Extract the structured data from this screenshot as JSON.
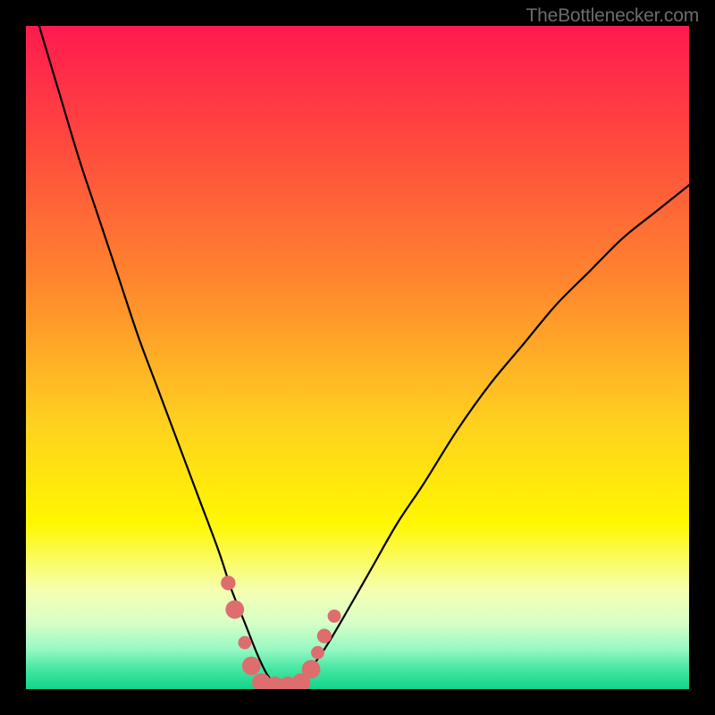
{
  "watermark": "TheBottlenecker.com",
  "chart_data": {
    "type": "line",
    "title": "",
    "xlabel": "",
    "ylabel": "",
    "xlim": [
      0,
      100
    ],
    "ylim": [
      0,
      100
    ],
    "grid": false,
    "series": [
      {
        "name": "bottleneck-curve",
        "x": [
          2,
          5,
          8,
          11,
          14,
          17,
          20,
          23,
          26,
          29,
          31,
          33,
          35,
          36.5,
          38,
          40,
          42,
          45,
          48,
          52,
          56,
          60,
          65,
          70,
          75,
          80,
          85,
          90,
          95,
          100
        ],
        "y": [
          100,
          90,
          80,
          71,
          62,
          53,
          45,
          37,
          29,
          21,
          15,
          10,
          5,
          2,
          0.5,
          0.5,
          2,
          6,
          11,
          18,
          25,
          31,
          39,
          46,
          52,
          58,
          63,
          68,
          72,
          76
        ],
        "color": "#000000"
      }
    ],
    "markers": [
      {
        "x": 30.5,
        "y": 16,
        "r": 1.1,
        "color": "#de6e6e"
      },
      {
        "x": 31.5,
        "y": 12,
        "r": 1.4,
        "color": "#de6e6e"
      },
      {
        "x": 33,
        "y": 7,
        "r": 1.0,
        "color": "#de6e6e"
      },
      {
        "x": 34,
        "y": 3.5,
        "r": 1.4,
        "color": "#de6e6e"
      },
      {
        "x": 35.5,
        "y": 1,
        "r": 1.4,
        "color": "#de6e6e"
      },
      {
        "x": 37.5,
        "y": 0.5,
        "r": 1.4,
        "color": "#de6e6e"
      },
      {
        "x": 39.5,
        "y": 0.5,
        "r": 1.4,
        "color": "#de6e6e"
      },
      {
        "x": 41.5,
        "y": 1,
        "r": 1.4,
        "color": "#de6e6e"
      },
      {
        "x": 43,
        "y": 3,
        "r": 1.4,
        "color": "#de6e6e"
      },
      {
        "x": 44,
        "y": 5.5,
        "r": 1.0,
        "color": "#de6e6e"
      },
      {
        "x": 45,
        "y": 8,
        "r": 1.1,
        "color": "#de6e6e"
      },
      {
        "x": 46.5,
        "y": 11,
        "r": 1.0,
        "color": "#de6e6e"
      }
    ],
    "gradient_stops": [
      {
        "offset": 0,
        "color": "#ff1a4f"
      },
      {
        "offset": 0.18,
        "color": "#ff4a3e"
      },
      {
        "offset": 0.4,
        "color": "#ff8b2d"
      },
      {
        "offset": 0.6,
        "color": "#ffd11f"
      },
      {
        "offset": 0.75,
        "color": "#fff700"
      },
      {
        "offset": 0.85,
        "color": "#f6ffb0"
      },
      {
        "offset": 0.9,
        "color": "#d8ffc8"
      },
      {
        "offset": 0.94,
        "color": "#97f8c2"
      },
      {
        "offset": 0.97,
        "color": "#45e6a3"
      },
      {
        "offset": 1.0,
        "color": "#11d48a"
      }
    ]
  }
}
